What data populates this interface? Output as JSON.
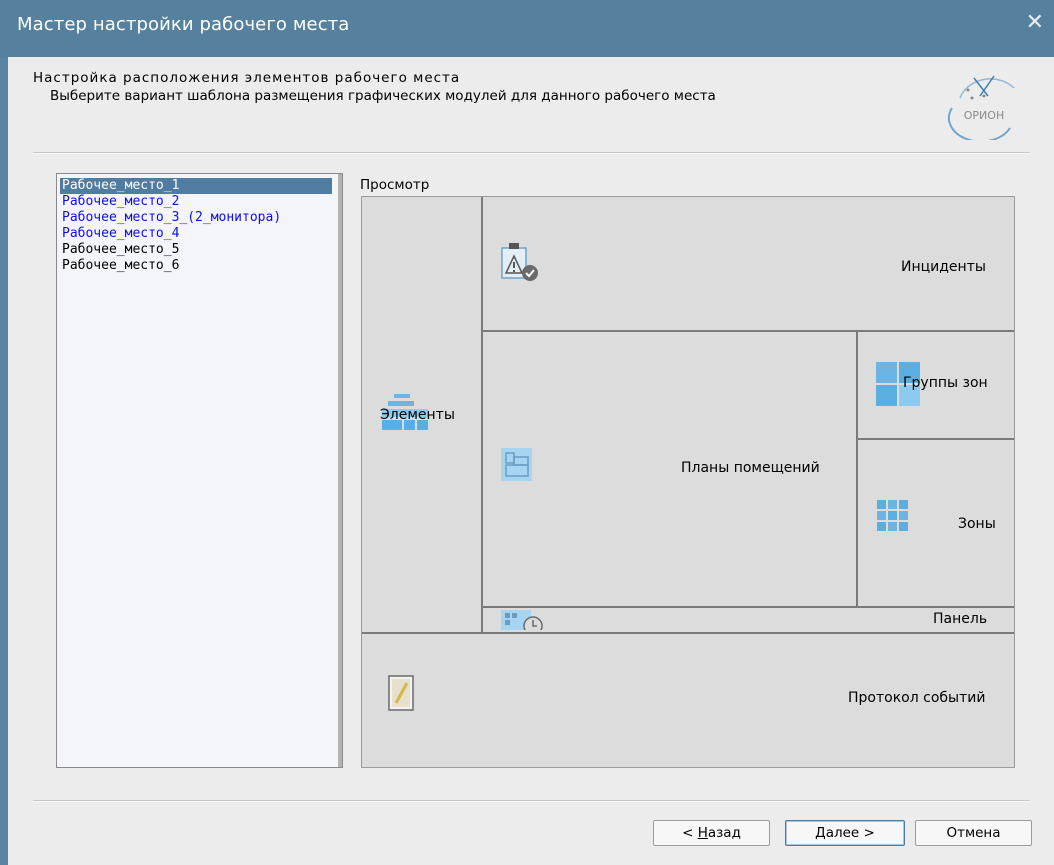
{
  "window": {
    "title": "Мастер настройки рабочего места",
    "close_glyph": "✕"
  },
  "header": {
    "title": "Настройка расположения элементов рабочего места",
    "subtitle": "Выберите вариант шаблона размещения графических модулей для данного рабочего места",
    "logo_text": "ОРИОН"
  },
  "workplaces": [
    {
      "label": "Рабочее_место_1",
      "state": "selected"
    },
    {
      "label": "Рабочее_место_2",
      "state": "blue"
    },
    {
      "label": "Рабочее_место_3_(2_монитора)",
      "state": "blue"
    },
    {
      "label": "Рабочее_место_4",
      "state": "blue"
    },
    {
      "label": "Рабочее_место_5",
      "state": "normal"
    },
    {
      "label": "Рабочее_место_6",
      "state": "normal"
    }
  ],
  "preview": {
    "label": "Просмотр",
    "panels": {
      "elements": "Элементы",
      "incidents": "Инциденты",
      "zone_groups": "Группы зон",
      "floor_plans": "Планы помещений",
      "zones": "Зоны",
      "panel": "Панель",
      "event_log": "Протокол событий"
    }
  },
  "buttons": {
    "back_prefix": "< ",
    "back_mnemonic": "Н",
    "back_rest": "азад",
    "next_mnemonic": "Д",
    "next_rest": "алее >",
    "cancel": "Отмена"
  },
  "colors": {
    "titlebar": "#55819f",
    "selection": "#4f7ca0",
    "link_blue": "#1010e0",
    "icon_blue": "#5aaee0"
  }
}
